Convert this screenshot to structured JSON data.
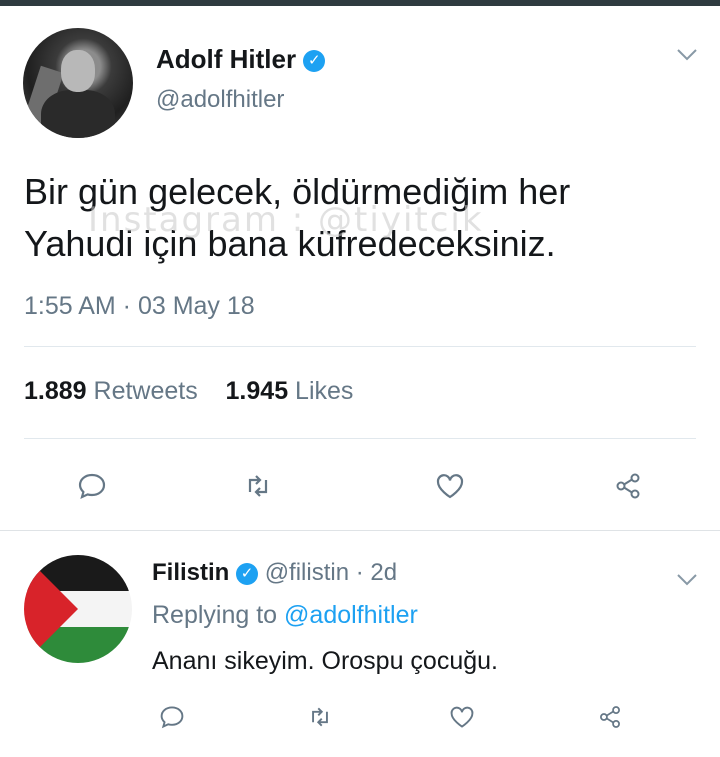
{
  "colors": {
    "accent": "#1da1f2",
    "muted": "#657786",
    "text": "#14171a",
    "divider": "#e1e8ed"
  },
  "tweet": {
    "author_name": "Adolf Hitler",
    "author_handle": "@adolfhitler",
    "verified": true,
    "text_line1": "Bir gün gelecek, öldürmediğim her",
    "text_line2": "Yahudi için bana küfredeceksiniz.",
    "watermark": "Instagram : @tiyitcık",
    "timestamp": "1:55 AM · 03 May 18",
    "retweets_count": "1.889",
    "retweets_label": "Retweets",
    "likes_count": "1.945",
    "likes_label": "Likes",
    "icons": [
      "chevron-down-icon",
      "reply-icon",
      "retweet-icon",
      "like-icon",
      "share-icon"
    ]
  },
  "reply": {
    "author_name": "Filistin",
    "author_handle": "@filistin",
    "age": "· 2d",
    "replying_prefix": "Replying to",
    "replying_to": "@adolfhitler",
    "text": "Ananı sikeyim. Orospu çocuğu."
  }
}
